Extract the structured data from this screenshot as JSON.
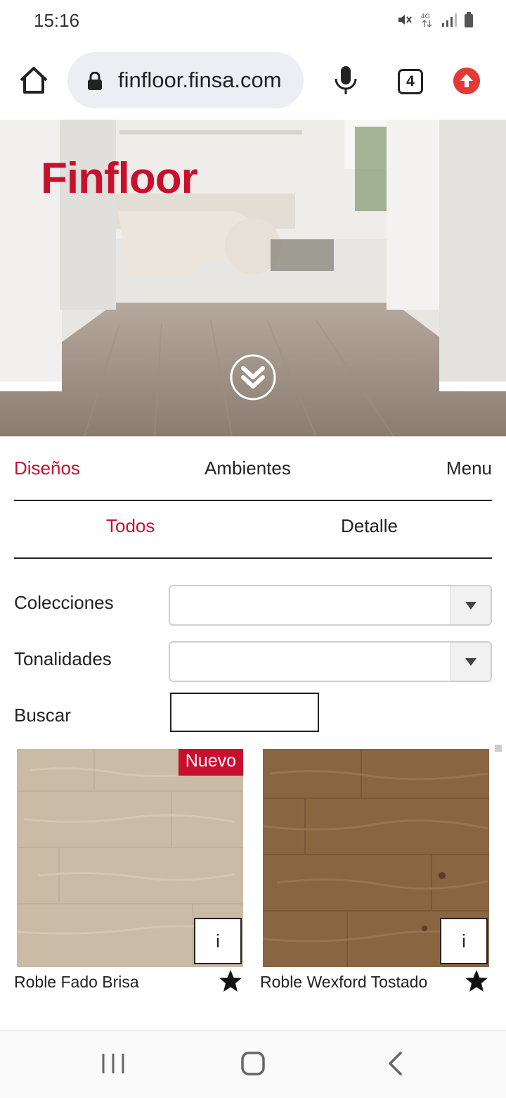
{
  "status_bar": {
    "time": "15:16",
    "icons": [
      "mute-icon",
      "network-4g-icon",
      "signal-icon",
      "battery-icon"
    ]
  },
  "browser": {
    "url": "finfloor.finsa.com",
    "tab_count": "4",
    "icons": [
      "home-icon",
      "lock-icon",
      "mic-icon",
      "tabs-icon",
      "update-icon"
    ]
  },
  "hero": {
    "brand": "Finfloor"
  },
  "main_nav": {
    "items": [
      {
        "label": "Diseños",
        "active": true
      },
      {
        "label": "Ambientes",
        "active": false
      },
      {
        "label": "Menu",
        "active": false
      }
    ]
  },
  "sub_nav": {
    "items": [
      {
        "label": "Todos",
        "active": true
      },
      {
        "label": "Detalle",
        "active": false
      }
    ]
  },
  "filters": {
    "colecciones_label": "Colecciones",
    "colecciones_value": "",
    "tonalidades_label": "Tonalidades",
    "tonalidades_value": "",
    "buscar_label": "Buscar",
    "buscar_value": ""
  },
  "products": [
    {
      "name": "Roble Fado Brisa",
      "badge": "Nuevo",
      "info": "i",
      "color": "#c9bba6"
    },
    {
      "name": "Roble Wexford Tostado",
      "badge": "",
      "info": "i",
      "color": "#8a6542"
    }
  ],
  "colors": {
    "accent": "#c8102e",
    "text": "#222222"
  }
}
